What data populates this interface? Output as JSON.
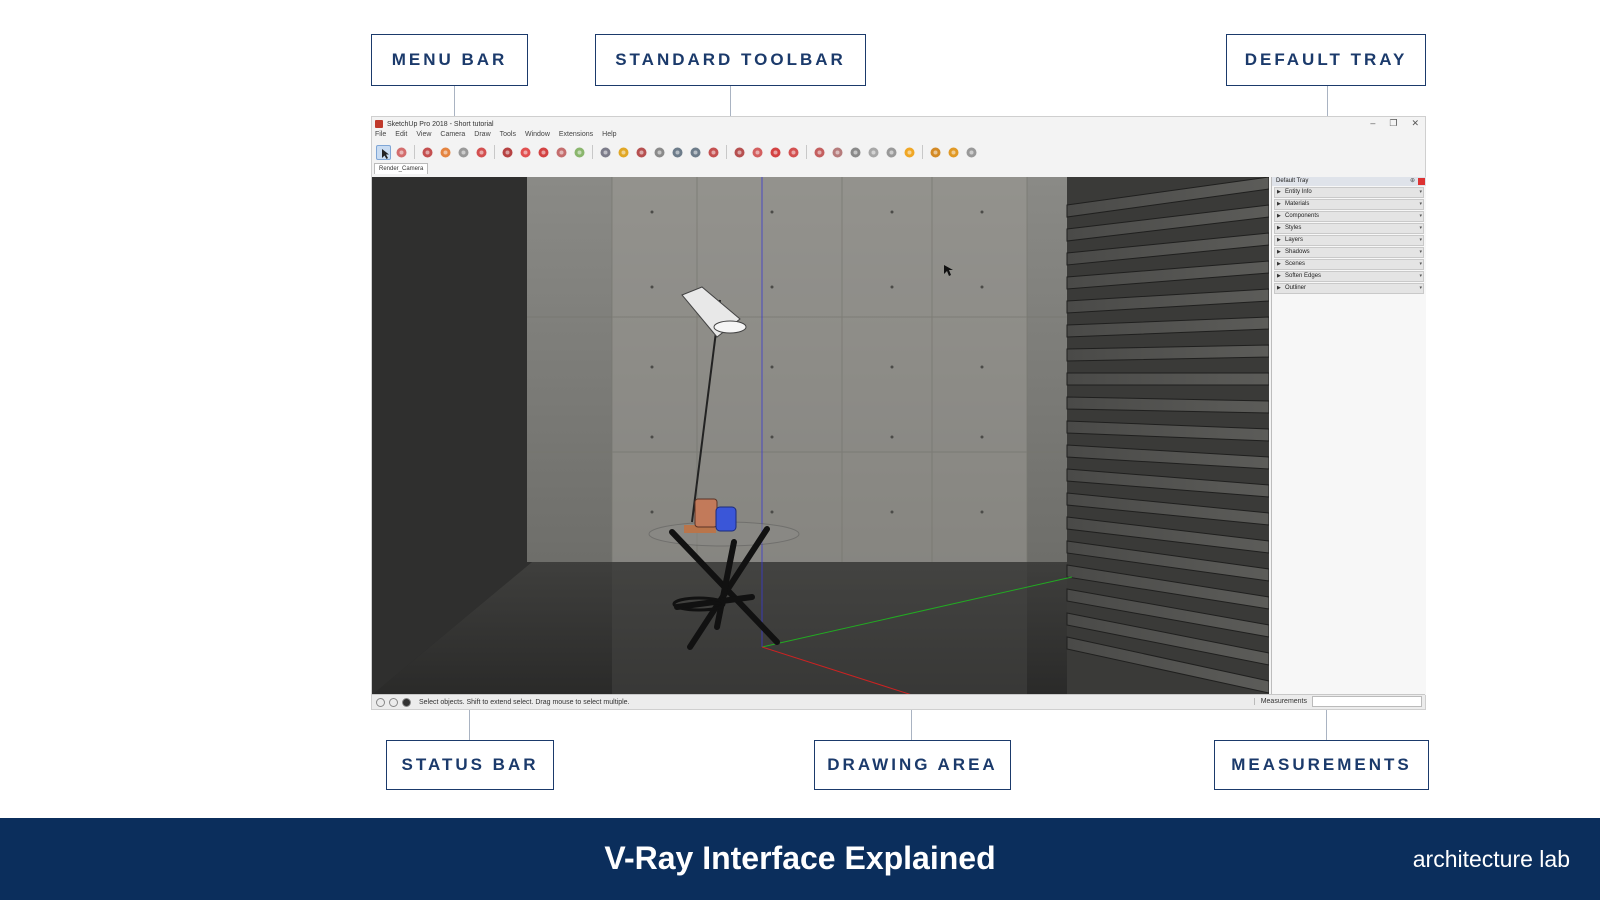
{
  "callouts": {
    "menu_bar": "MENU BAR",
    "standard_toolbar": "STANDARD TOOLBAR",
    "default_tray": "DEFAULT TRAY",
    "status_bar": "STATUS BAR",
    "drawing_area": "DRAWING AREA",
    "measurements": "MEASUREMENTS"
  },
  "app": {
    "title": "SketchUp Pro 2018 - Short tutorial",
    "window_controls": [
      "–",
      "❐",
      "✕"
    ],
    "menu": [
      "File",
      "Edit",
      "View",
      "Camera",
      "Draw",
      "Tools",
      "Window",
      "Extensions",
      "Help"
    ],
    "scene_tab": "Render_Camera",
    "toolbar_icons": [
      "select-icon",
      "eraser-icon",
      "pencil-icon",
      "arc-icon",
      "shape-icon",
      "push-pull-icon",
      "follow-me-icon",
      "move-icon",
      "rotate-icon",
      "scale-icon",
      "tape-icon",
      "text-icon",
      "paint-icon",
      "orbit-icon",
      "pan-icon",
      "zoom-icon",
      "zoom-extents-icon",
      "warehouse-icon",
      "extension-icon",
      "layout-icon",
      "ruby-icon",
      "vray-render-icon",
      "vray-ipr-icon",
      "vray-frame-icon",
      "vray-lights-icon",
      "vray-sphere-icon",
      "vray-mesh-icon",
      "section-icon",
      "views-icon",
      "styles-icon",
      "sandbox-icon"
    ],
    "tray": {
      "title": "Default Tray",
      "items": [
        "Entity Info",
        "Materials",
        "Components",
        "Styles",
        "Layers",
        "Shadows",
        "Scenes",
        "Soften Edges",
        "Outliner"
      ]
    },
    "status": {
      "text": "Select objects. Shift to extend select. Drag mouse to select multiple.",
      "measurements_label": "Measurements",
      "measurements_value": ""
    }
  },
  "colors": {
    "brand_navy": "#0b2e5c",
    "callout_text": "#1b3a6b",
    "selection_highlight": "#c9dcf2"
  },
  "footer": {
    "title": "V-Ray Interface Explained",
    "brand": "architecture lab"
  }
}
